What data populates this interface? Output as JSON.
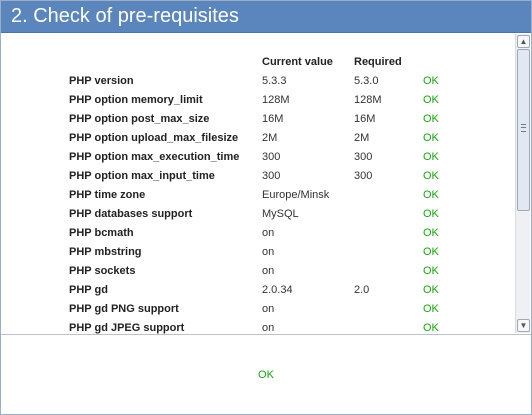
{
  "window": {
    "title": "2. Check of pre-requisites"
  },
  "table": {
    "headers": {
      "name": "",
      "current": "Current value",
      "required": "Required",
      "result": ""
    },
    "rows": [
      {
        "name": "PHP version",
        "current": "5.3.3",
        "required": "5.3.0",
        "result": "OK"
      },
      {
        "name": "PHP option memory_limit",
        "current": "128M",
        "required": "128M",
        "result": "OK"
      },
      {
        "name": "PHP option post_max_size",
        "current": "16M",
        "required": "16M",
        "result": "OK"
      },
      {
        "name": "PHP option upload_max_filesize",
        "current": "2M",
        "required": "2M",
        "result": "OK"
      },
      {
        "name": "PHP option max_execution_time",
        "current": "300",
        "required": "300",
        "result": "OK"
      },
      {
        "name": "PHP option max_input_time",
        "current": "300",
        "required": "300",
        "result": "OK"
      },
      {
        "name": "PHP time zone",
        "current": "Europe/Minsk",
        "required": "",
        "result": "OK"
      },
      {
        "name": "PHP databases support",
        "current": "MySQL",
        "required": "",
        "result": "OK"
      },
      {
        "name": "PHP bcmath",
        "current": "on",
        "required": "",
        "result": "OK"
      },
      {
        "name": "PHP mbstring",
        "current": "on",
        "required": "",
        "result": "OK"
      },
      {
        "name": "PHP sockets",
        "current": "on",
        "required": "",
        "result": "OK"
      },
      {
        "name": "PHP gd",
        "current": "2.0.34",
        "required": "2.0",
        "result": "OK"
      },
      {
        "name": "PHP gd PNG support",
        "current": "on",
        "required": "",
        "result": "OK"
      },
      {
        "name": "PHP gd JPEG support",
        "current": "on",
        "required": "",
        "result": "OK"
      }
    ]
  },
  "scrollbar": {
    "up_icon": "scroll-up-arrow-icon",
    "down_icon": "scroll-down-arrow-icon",
    "up_glyph": "▲",
    "down_glyph": "▼"
  },
  "footer": {
    "status": "OK"
  },
  "colors": {
    "titlebar": "#5b86bd",
    "ok": "#19a30f"
  }
}
